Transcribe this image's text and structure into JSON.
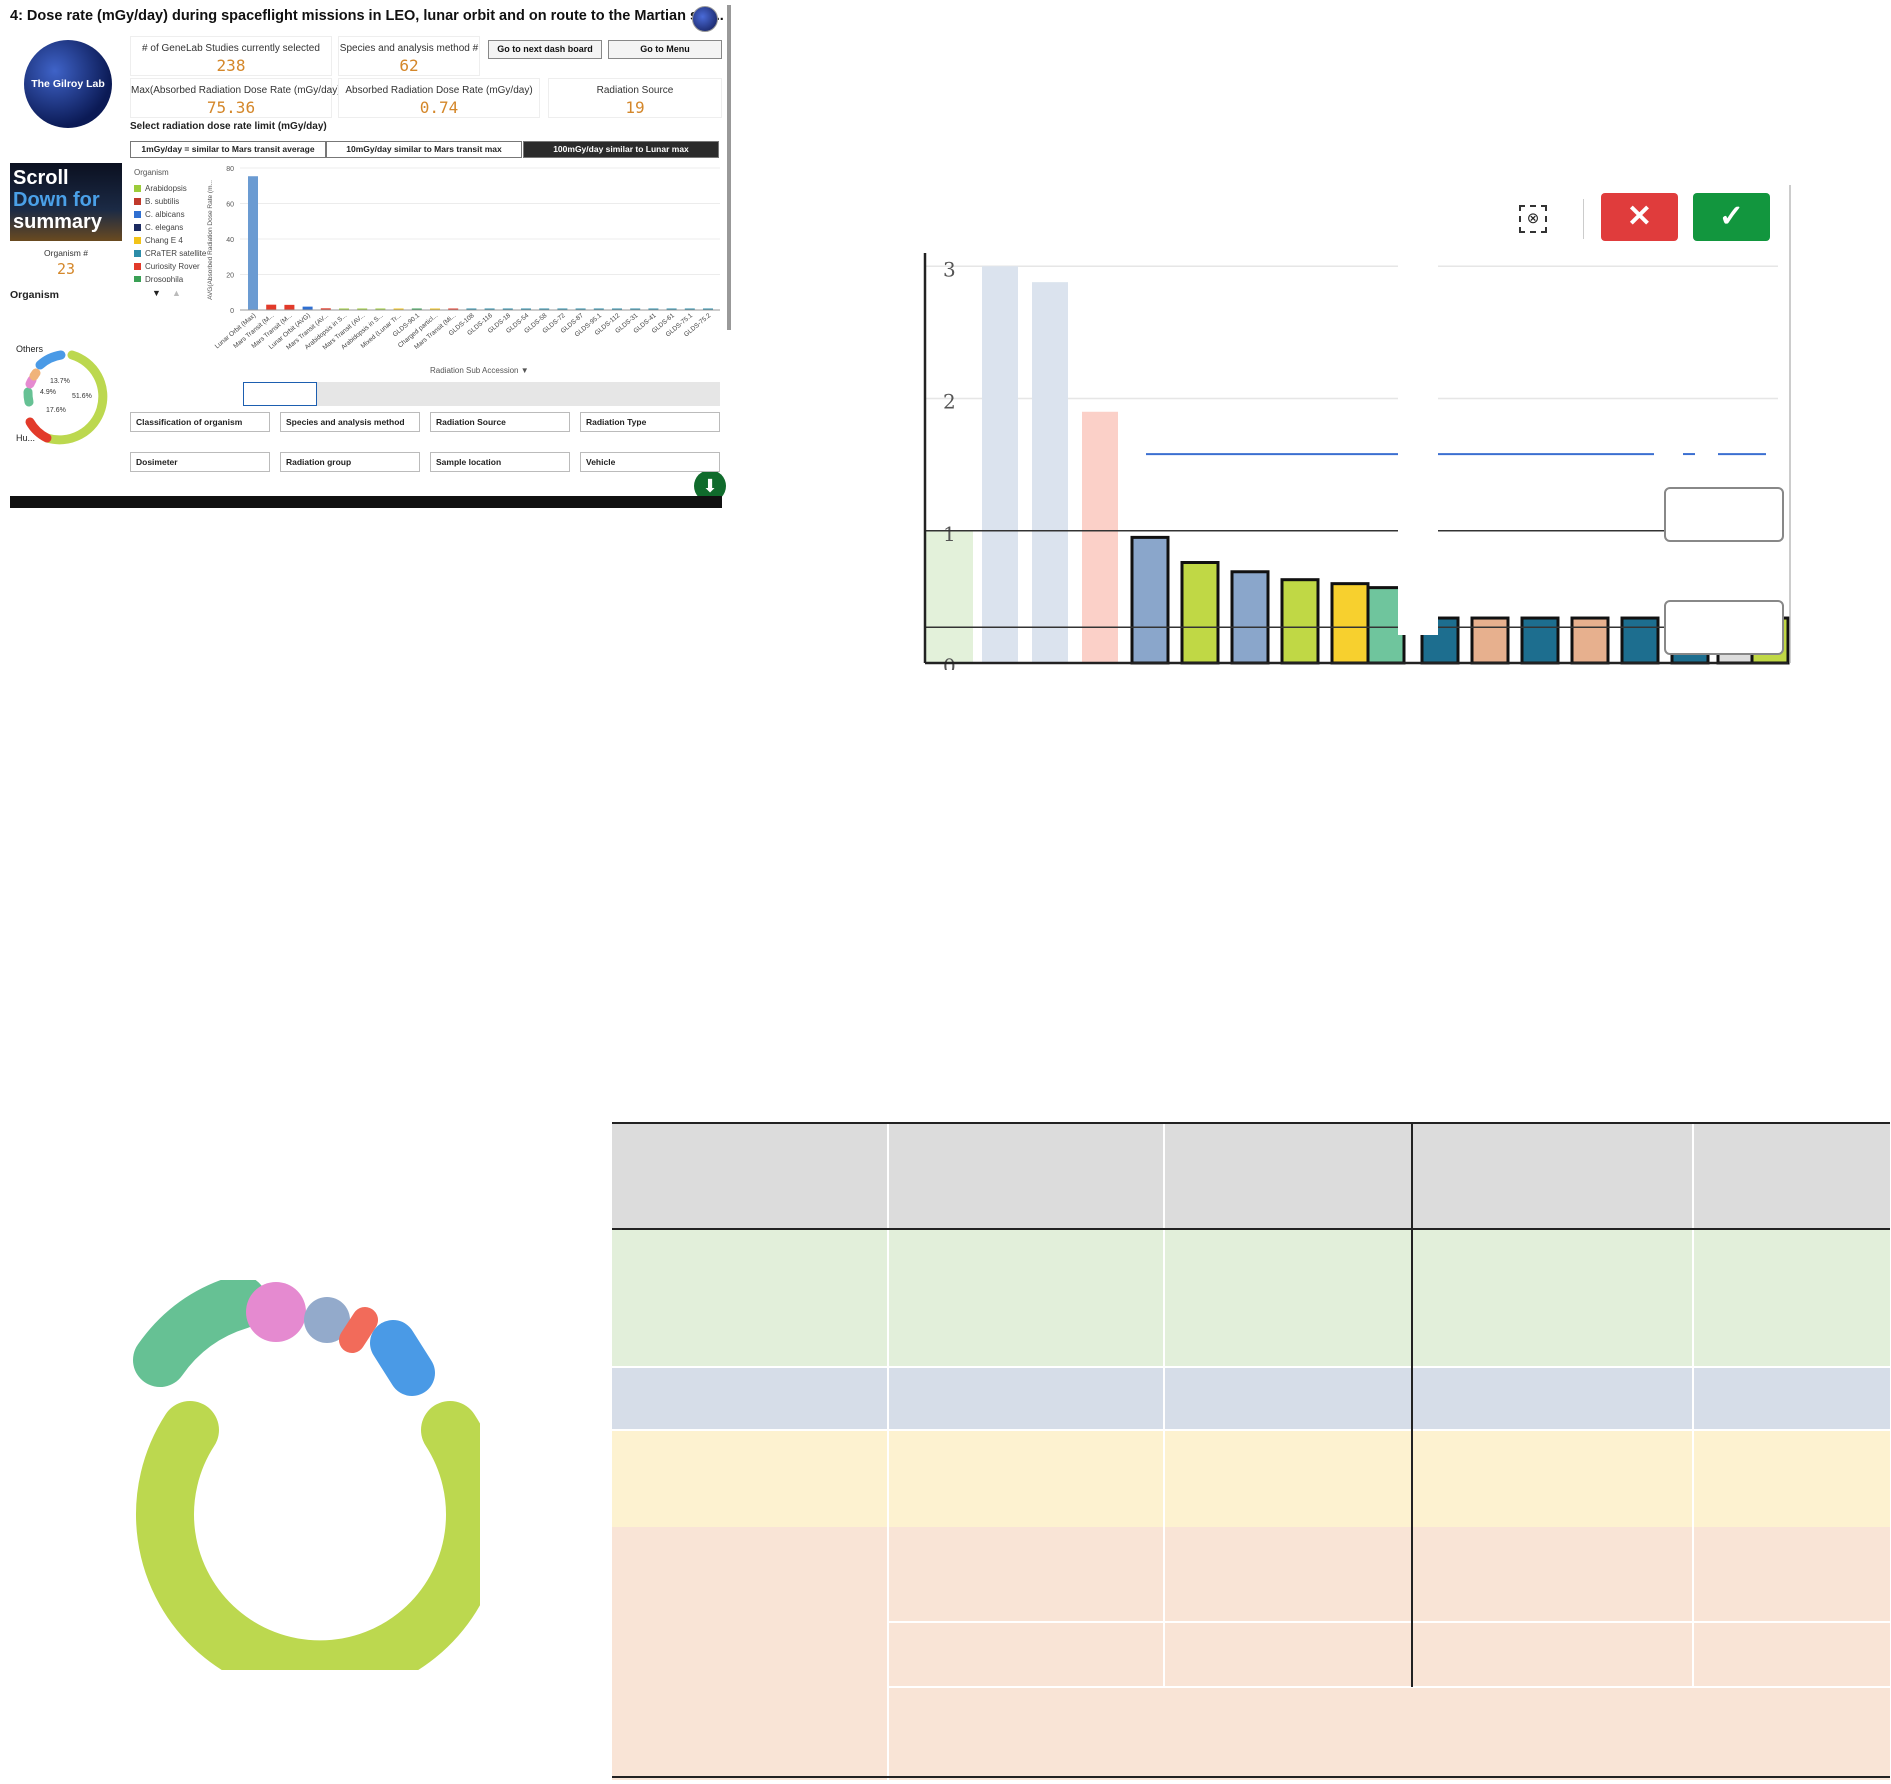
{
  "dashboard": {
    "title": "4: Dose rate (mGy/day) during spaceflight missions in LEO, lunar orbit and on route to the Martian sur...",
    "logo_text": "The Gilroy Lab",
    "kpis": [
      {
        "label": "# of GeneLab Studies currently selected",
        "value": "238"
      },
      {
        "label": "Species and analysis method #",
        "value": "62"
      },
      {
        "label": "Max(Absorbed Radiation Dose Rate (mGy/day))",
        "value": "75.36"
      },
      {
        "label": "Absorbed Radiation Dose Rate (mGy/day)",
        "value": "0.74"
      },
      {
        "label": "Radiation Source",
        "value": "19"
      }
    ],
    "buttons": {
      "next": "Go to next dash board",
      "menu": "Go to Menu"
    },
    "scroll_text": [
      "Scroll",
      "Down for",
      "summary"
    ],
    "organism_kpi": {
      "label": "Organism #",
      "value": "23"
    },
    "organism_title": "Organism",
    "donut": {
      "labels": {
        "others": "Others",
        "hu": "Hu..."
      },
      "pct": [
        "13.7%",
        "4.9%",
        "51.6%",
        "17.6%"
      ]
    },
    "select_label": "Select radiation dose rate limit (mGy/day)",
    "tabs": [
      {
        "label": "1mGy/day = similar to Mars transit average",
        "active": false
      },
      {
        "label": "10mGy/day similar to Mars transit max",
        "active": false
      },
      {
        "label": "100mGy/day similar to Lunar max",
        "active": true
      }
    ],
    "legend_title": "Organism",
    "legend": [
      {
        "name": "Arabidopsis",
        "color": "#9ccc3a"
      },
      {
        "name": "B. subtilis",
        "color": "#c0392b"
      },
      {
        "name": "C. albicans",
        "color": "#2f6fd1"
      },
      {
        "name": "C. elegans",
        "color": "#1b2a60"
      },
      {
        "name": "Chang E 4",
        "color": "#f2c318"
      },
      {
        "name": "CRaTER satellite",
        "color": "#2c8ca8"
      },
      {
        "name": "Curiosity Rover",
        "color": "#e23a2a"
      },
      {
        "name": "Drosophila",
        "color": "#3aa055"
      }
    ],
    "filters": [
      "Classification of organism",
      "Species and analysis method",
      "Radiation Source",
      "Radiation Type",
      "Dosimeter",
      "Radiation group",
      "Sample location",
      "Vehicle"
    ]
  },
  "chart_data": [
    {
      "type": "bar",
      "title": "",
      "xlabel": "Radiation Sub Accession",
      "ylabel": "AVG(Absorbed Radiation Dose Rate (m...",
      "ylim": [
        0,
        80
      ],
      "yticks": [
        0,
        20,
        40,
        60,
        80
      ],
      "categories": [
        "Lunar Orbit (Max)",
        "Mars Transit (M...",
        "Mars Transit (M...",
        "Lunar Orbit (AVG)",
        "Mars Transit (AV...",
        "Arabidopsis in S...",
        "Mars Transit (AV...",
        "Arabidopsis in S...",
        "Mixed (Lunar Tr...",
        "GLDS-90.1",
        "Charged particl...",
        "Mars Transit (Mi...",
        "GLDS-108",
        "GLDS-116",
        "GLDS-18",
        "GLDS-54",
        "GLDS-58",
        "GLDS-72",
        "GLDS-87",
        "GLDS-95.1",
        "GLDS-112",
        "GLDS-31",
        "GLDS-41",
        "GLDS-61",
        "GLDS-75.1",
        "GLDS-75.2"
      ],
      "values": [
        75.36,
        3.0,
        2.9,
        1.9,
        0.95,
        0.75,
        0.68,
        0.62,
        0.6,
        0.55,
        0.5,
        0.45,
        0.4,
        0.38,
        0.36,
        0.35,
        0.34,
        0.33,
        0.32,
        0.31,
        0.3,
        0.3,
        0.29,
        0.28,
        0.27,
        0.26
      ],
      "colors": [
        "#6b9bd2",
        "#e23a2a",
        "#e23a2a",
        "#2f6fd1",
        "#e23a2a",
        "#9ccc3a",
        "#9ccc3a",
        "#9ccc3a",
        "#f2c318",
        "#3aa055",
        "#f2c318",
        "#e23a2a",
        "#2c8ca8",
        "#2c8ca8",
        "#2c8ca8",
        "#2c8ca8",
        "#2c8ca8",
        "#2c8ca8",
        "#2c8ca8",
        "#2c8ca8",
        "#2c8ca8",
        "#2c8ca8",
        "#2c8ca8",
        "#2c8ca8",
        "#2c8ca8",
        "#2c8ca8"
      ]
    },
    {
      "type": "bar",
      "title": "",
      "yticks": [
        0,
        1,
        2,
        3
      ],
      "ylim": [
        0,
        3.2
      ],
      "values": [
        3.0,
        2.88,
        1.9,
        0.95,
        0.76,
        0.69,
        0.63,
        0.6,
        0.57,
        0.34,
        0.34,
        0.34,
        0.34,
        0.34,
        0.34,
        0.34,
        0.34
      ],
      "colors": [
        "#dbe3ee",
        "#dbe3ee",
        "#fbd0c8",
        "#8aa6cb",
        "#c0d845",
        "#8aa6cb",
        "#c0d845",
        "#f7d02e",
        "#6fc59d",
        "#1d6e8f",
        "#e7b08e",
        "#1d6e8f",
        "#e7b08e",
        "#1d6e8f",
        "#1d6e8f",
        "#dddddd",
        "#c0d845"
      ],
      "reference_lines": [
        1.0,
        0.27
      ],
      "trend_line": 1.58
    }
  ],
  "zoom_controls": {
    "lasso_icon": "lasso-clear-icon",
    "cancel_icon": "close-icon",
    "confirm_icon": "check-icon",
    "cancel_color": "#e03c3c",
    "confirm_color": "#12963e"
  },
  "donut_large": {
    "segments": [
      "#bcd84f",
      "#66c194",
      "#e58ad0",
      "#93aacb",
      "#f26b5a",
      "#4a9ae6"
    ]
  },
  "table": {
    "row_colors": [
      "#dcdcdc",
      "#e2efda",
      "#d6dde8",
      "#fdf2d0",
      "#f9e4d6"
    ]
  }
}
